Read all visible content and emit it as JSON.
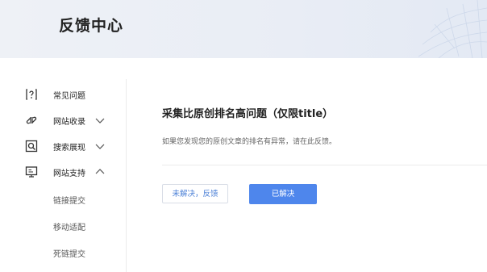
{
  "header": {
    "title": "反馈中心"
  },
  "sidebar": {
    "items": [
      {
        "label": "常见问题",
        "icon": "question-doc-icon"
      },
      {
        "label": "网站收录",
        "icon": "link-icon",
        "chevron": "chevron-down-icon"
      },
      {
        "label": "搜索展现",
        "icon": "search-display-icon",
        "chevron": "chevron-down-icon"
      },
      {
        "label": "网站支持",
        "icon": "monitor-icon",
        "chevron": "chevron-up-icon",
        "subitems": [
          "链接提交",
          "移动适配",
          "死链提交"
        ]
      }
    ]
  },
  "main": {
    "question_title": "采集比原创排名高问题（仅限title）",
    "description": "如果您发现您的原创文章的排名有异常，请在此反馈。",
    "buttons": {
      "unresolved": "未解决，反馈",
      "resolved": "已解决"
    }
  },
  "colors": {
    "primary": "#4e86ec",
    "link": "#4a7fd6",
    "header_bg": "#eef1f6"
  }
}
